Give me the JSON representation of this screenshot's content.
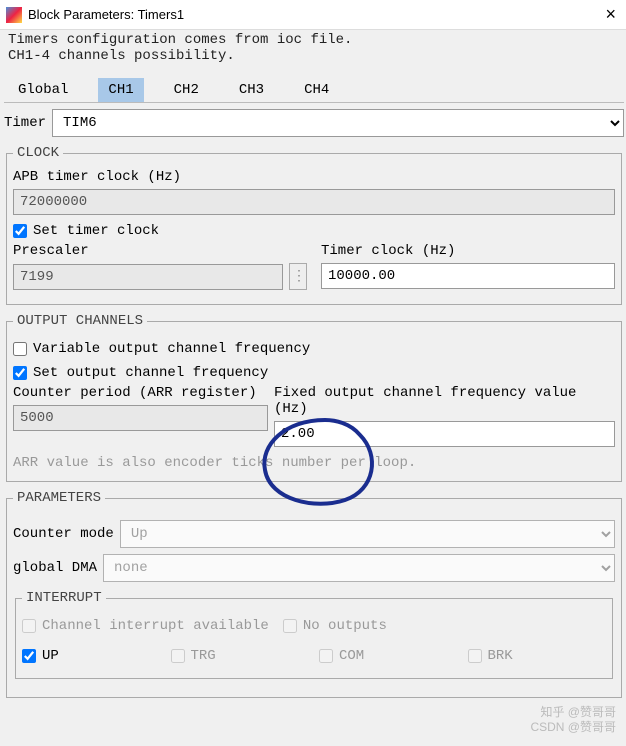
{
  "window": {
    "title": "Block Parameters: Timers1",
    "close": "×"
  },
  "description": {
    "line1": "Timers configuration comes from ioc file.",
    "line2": "CH1-4 channels possibility."
  },
  "tabs": [
    "Global",
    "CH1",
    "CH2",
    "CH3",
    "CH4"
  ],
  "active_tab": "CH1",
  "timer": {
    "label": "Timer",
    "value": "TIM6"
  },
  "clock": {
    "legend": "CLOCK",
    "apb_label": "APB timer clock (Hz)",
    "apb_value": "72000000",
    "set_timer_clock_label": "Set timer clock",
    "set_timer_clock_checked": true,
    "prescaler_label": "Prescaler",
    "prescaler_value": "7199",
    "timer_clock_label": "Timer clock (Hz)",
    "timer_clock_value": "10000.00"
  },
  "output": {
    "legend": "OUTPUT CHANNELS",
    "variable_freq_label": "Variable output channel frequency",
    "variable_freq_checked": false,
    "set_freq_label": "Set output channel frequency",
    "set_freq_checked": true,
    "counter_period_label": "Counter period (ARR register)",
    "counter_period_value": "5000",
    "fixed_freq_label": "Fixed output channel frequency value (Hz)",
    "fixed_freq_value": "2.00",
    "hint": "ARR value is also encoder ticks number per loop."
  },
  "parameters": {
    "legend": "PARAMETERS",
    "counter_mode_label": "Counter mode",
    "counter_mode_value": "Up",
    "global_dma_label": "global DMA",
    "global_dma_value": "none"
  },
  "interrupt": {
    "legend": "INTERRUPT",
    "channel_available_label": "Channel interrupt available",
    "channel_available_checked": false,
    "no_outputs_label": "No outputs",
    "no_outputs_checked": false,
    "items": [
      {
        "label": "UP",
        "checked": true,
        "enabled": true
      },
      {
        "label": "TRG",
        "checked": false,
        "enabled": false
      },
      {
        "label": "COM",
        "checked": false,
        "enabled": false
      },
      {
        "label": "BRK",
        "checked": false,
        "enabled": false
      }
    ]
  },
  "watermark": {
    "line1": "知乎 @赞哥哥",
    "line2": "CSDN @赞哥哥"
  }
}
